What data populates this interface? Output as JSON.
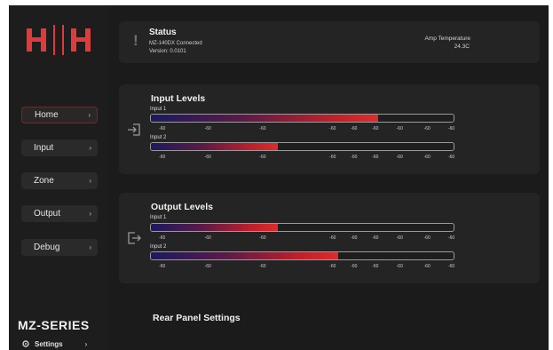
{
  "sidebar": {
    "logo": "H|H",
    "items": [
      {
        "label": "Home",
        "active": true
      },
      {
        "label": "Input",
        "active": false
      },
      {
        "label": "Zone",
        "active": false
      },
      {
        "label": "Output",
        "active": false
      },
      {
        "label": "Debug",
        "active": false
      }
    ],
    "brand": "MZ-SERIES",
    "settings_label": "Settings",
    "chevron": "›"
  },
  "status": {
    "title": "Status",
    "connection": "MZ-140DX Connected",
    "version": "Version: 0.0101",
    "amp_temp_label": "Amp Temperature",
    "amp_temp_value": "24.3C",
    "icon": "exclamation-icon"
  },
  "input_levels": {
    "title": "Input Levels",
    "icon": "input-arrow-icon",
    "channels": [
      {
        "label": "Input 1",
        "level": 0.75
      },
      {
        "label": "Input 2",
        "level": 0.42
      }
    ],
    "tick_labels": [
      "-60",
      "-60",
      "-60",
      "-60",
      "-60",
      "-60",
      "-60",
      "-60",
      "-60"
    ]
  },
  "output_levels": {
    "title": "Output Levels",
    "icon": "output-arrow-icon",
    "channels": [
      {
        "label": "Input 1",
        "level": 0.42
      },
      {
        "label": "Input 2",
        "level": 0.62
      }
    ],
    "tick_labels": [
      "-60",
      "-60",
      "-60",
      "-60",
      "-60",
      "-60",
      "-60",
      "-60",
      "-60"
    ]
  },
  "rear_panel": {
    "title": "Rear Panel Settings"
  },
  "colors": {
    "accent_red": "#de2b2b",
    "meter_start": "#1b1a5e",
    "background": "#1b1b1b",
    "panel": "#242424"
  }
}
